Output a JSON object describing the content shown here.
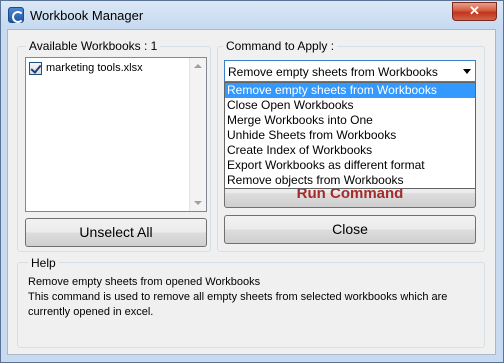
{
  "window": {
    "title": "Workbook Manager",
    "close_glyph": "✕"
  },
  "workbooks": {
    "label": "Available Workbooks : 1",
    "items": [
      {
        "name": "marketing tools.xlsx",
        "checked": true
      }
    ],
    "unselect_label": "Unselect All"
  },
  "command": {
    "label": "Command to Apply :",
    "selected": "Remove empty sheets from Workbooks",
    "options": [
      "Remove empty sheets from Workbooks",
      "Close Open Workbooks",
      "Merge Workbooks into One",
      "Unhide Sheets from Workbooks",
      "Create Index of Workbooks",
      "Export Workbooks as different format",
      "Remove objects from Workbooks"
    ],
    "run_label": "Run Command",
    "close_label": "Close"
  },
  "help": {
    "label": "Help",
    "line1": "Remove empty sheets from opened Workbooks",
    "line2": "This command is used to remove all empty sheets from selected workbooks which are",
    "line3": "currently opened in excel."
  },
  "colors": {
    "selection": "#3399ff",
    "run_text": "#a52a2a",
    "close_button": "#c1341b"
  }
}
